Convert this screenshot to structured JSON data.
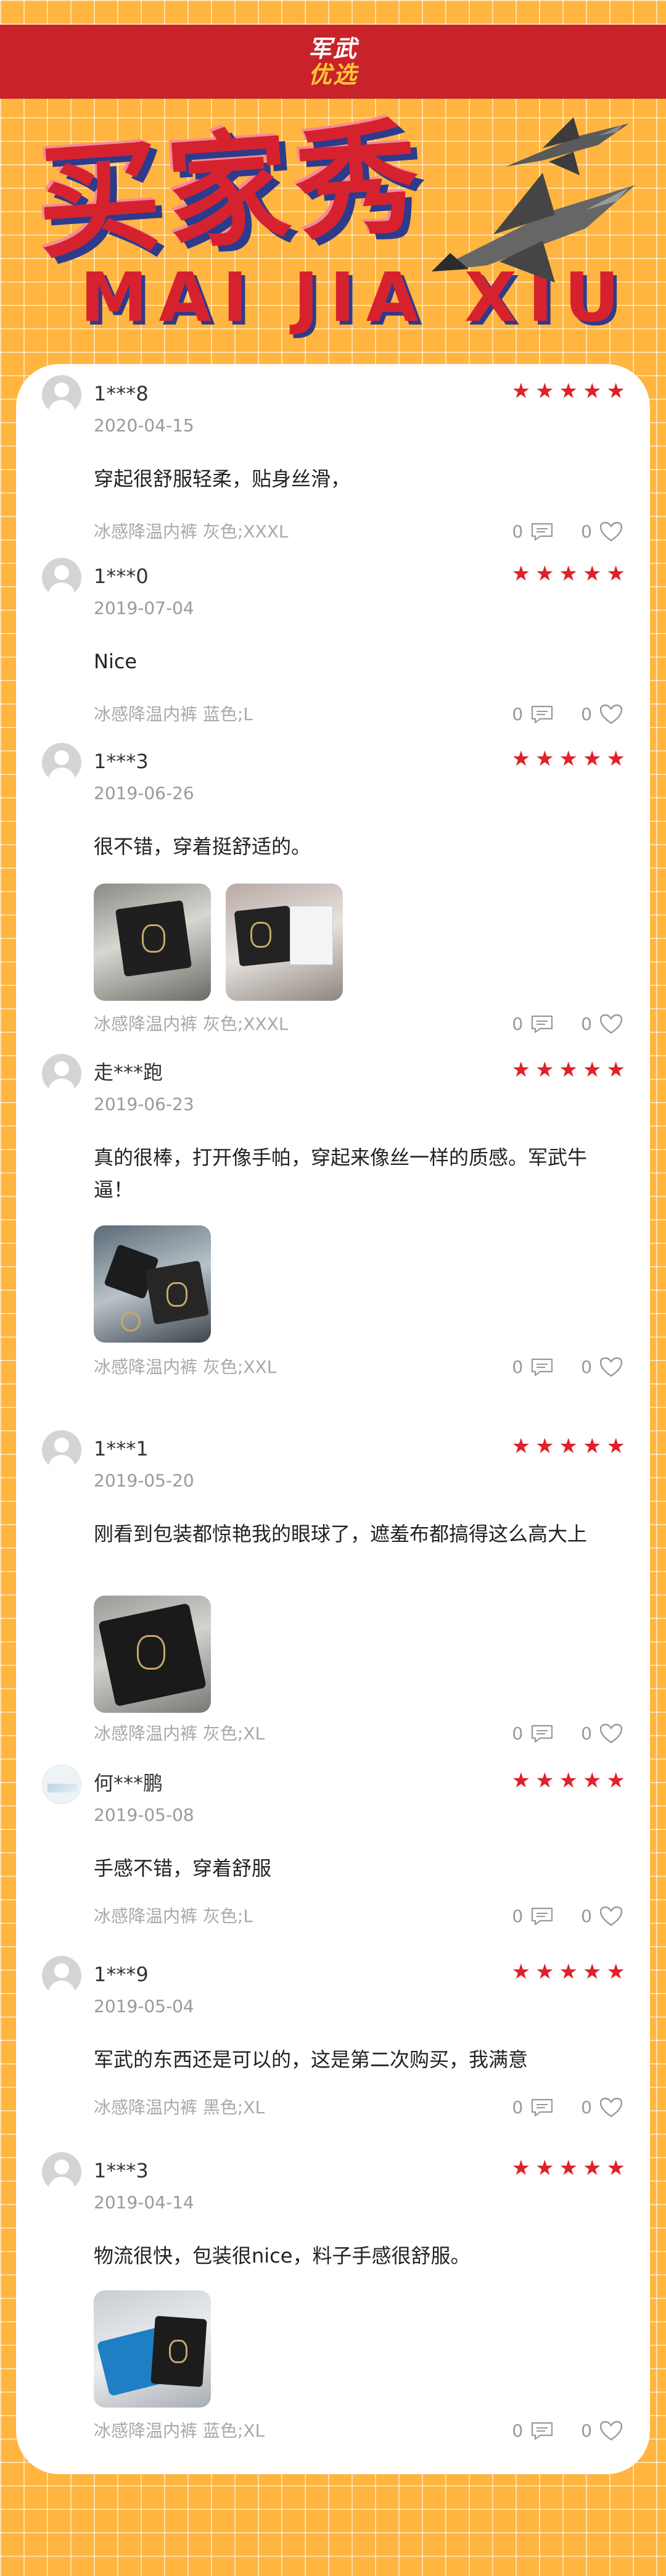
{
  "brand": {
    "top": "军武",
    "bottom": "优选"
  },
  "hero": {
    "title": "买家秀",
    "subtitle": "MAI JIA XIU"
  },
  "colors": {
    "red": "#c8232a",
    "orange": "#ffb540",
    "star": "#e0202a"
  },
  "reviews": [
    {
      "name": "1***8",
      "rating": 5,
      "date": "2020-04-15",
      "content": "穿起很舒服轻柔，贴身丝滑，",
      "spec": "冰感降温内裤 灰色;XXXL",
      "comments": "0",
      "likes": "0"
    },
    {
      "name": "1***0",
      "rating": 5,
      "date": "2019-07-04",
      "content": "Nice",
      "spec": "冰感降温内裤 蓝色;L",
      "comments": "0",
      "likes": "0"
    },
    {
      "name": "1***3",
      "rating": 5,
      "date": "2019-06-26",
      "content": "很不错，穿着挺舒适的。",
      "spec": "冰感降温内裤 灰色;XXXL",
      "comments": "0",
      "likes": "0"
    },
    {
      "name": "走***跑",
      "rating": 5,
      "date": "2019-06-23",
      "content": "真的很棒，打开像手帕，穿起来像丝一样的质感。军武牛逼！",
      "spec": "冰感降温内裤 灰色;XXL",
      "comments": "0",
      "likes": "0"
    },
    {
      "name": "1***1",
      "rating": 5,
      "date": "2019-05-20",
      "content": "刚看到包装都惊艳我的眼球了，遮羞布都搞得这么高大上",
      "spec": "冰感降温内裤 灰色;XL",
      "comments": "0",
      "likes": "0"
    },
    {
      "name": "何***鹏",
      "rating": 5,
      "date": "2019-05-08",
      "content": "手感不错，穿着舒服",
      "spec": "冰感降温内裤 灰色;L",
      "comments": "0",
      "likes": "0"
    },
    {
      "name": "1***9",
      "rating": 5,
      "date": "2019-05-04",
      "content": "军武的东西还是可以的，这是第二次购买，我满意",
      "spec": "冰感降温内裤 黑色;XL",
      "comments": "0",
      "likes": "0"
    },
    {
      "name": "1***3",
      "rating": 5,
      "date": "2019-04-14",
      "content": "物流很快，包装很nice，料子手感很舒服。",
      "spec": "冰感降温内裤 蓝色;XL",
      "comments": "0",
      "likes": "0"
    }
  ],
  "icons": {
    "comment": "comment-icon",
    "like": "heart-icon",
    "star": "star-icon"
  }
}
